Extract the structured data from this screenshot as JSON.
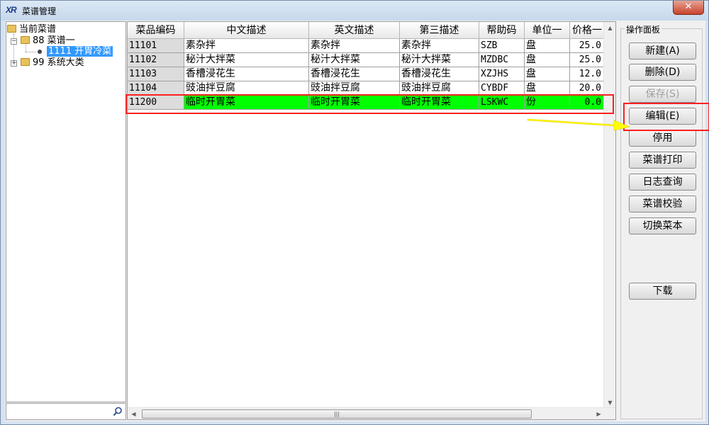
{
  "window": {
    "title": "菜谱管理",
    "icon_text": "XR",
    "close_label": "✕"
  },
  "tree": {
    "nodes": [
      {
        "label": "当前菜谱"
      },
      {
        "label": "88  菜谱一"
      },
      {
        "label": "1111  开胃冷菜"
      },
      {
        "label": "99  系统大类"
      }
    ],
    "search_placeholder": ""
  },
  "grid": {
    "columns": [
      "菜品编码",
      "中文描述",
      "英文描述",
      "第三描述",
      "帮助码",
      "单位一",
      "价格一"
    ],
    "rows": [
      [
        "11101",
        "素杂拌",
        "素杂拌",
        "素杂拌",
        "SZB",
        "盘",
        "25.0"
      ],
      [
        "11102",
        "秘汁大拌菜",
        "秘汁大拌菜",
        "秘汁大拌菜",
        "MZDBC",
        "盘",
        "25.0"
      ],
      [
        "11103",
        "香槽浸花生",
        "香槽浸花生",
        "香槽浸花生",
        "XZJHS",
        "盘",
        "12.0"
      ],
      [
        "11104",
        "豉油拌豆腐",
        "豉油拌豆腐",
        "豉油拌豆腐",
        "CYBDF",
        "盘",
        "20.0"
      ],
      [
        "11200",
        "临时开胃菜",
        "临时开胃菜",
        "临时开胃菜",
        "LSKWC",
        "份",
        "0.0"
      ]
    ],
    "highlight_color": "#00ff00"
  },
  "ops": {
    "title": "操作面板",
    "buttons": {
      "new": "新建(A)",
      "delete": "删除(D)",
      "save": "保存(S)",
      "edit": "编辑(E)",
      "disable": "停用",
      "print": "菜谱打印",
      "log": "日志查询",
      "verify": "菜谱校验",
      "switch": "切换菜本",
      "download": "下载"
    }
  },
  "colors": {
    "annotation_red": "#ff2020",
    "annotation_arrow": "#ffff00",
    "selection_blue": "#3399ff"
  }
}
